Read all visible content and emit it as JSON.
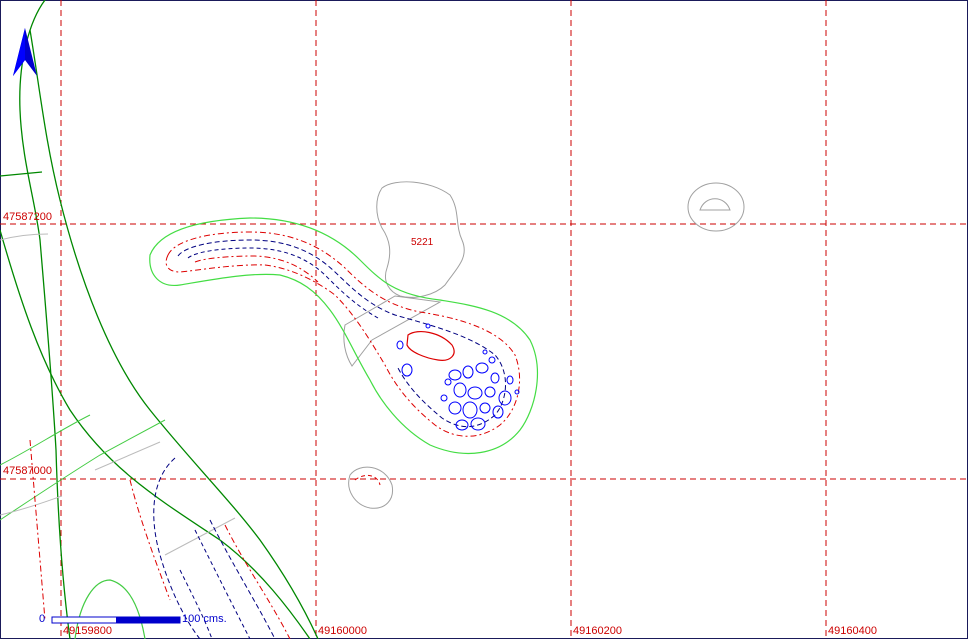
{
  "map": {
    "north_arrow_icon": "north-arrow-icon",
    "grid": {
      "x_labels": [
        "49159800",
        "49160000",
        "49160200",
        "49160400"
      ],
      "y_labels": [
        "47587200",
        "47587000"
      ]
    },
    "feature_label": "5221",
    "scale_bar": {
      "start_label": "0",
      "end_label": "100 cms."
    },
    "colors": {
      "grid": "#cc0000",
      "green_line": "#00aa00",
      "dark_green_line": "#007700",
      "blue_contour": "#000080",
      "bright_blue": "#0000ff",
      "red_contour": "#dd0000",
      "grey_outline": "#a0a0a0",
      "light_green": "#66dd66"
    }
  }
}
